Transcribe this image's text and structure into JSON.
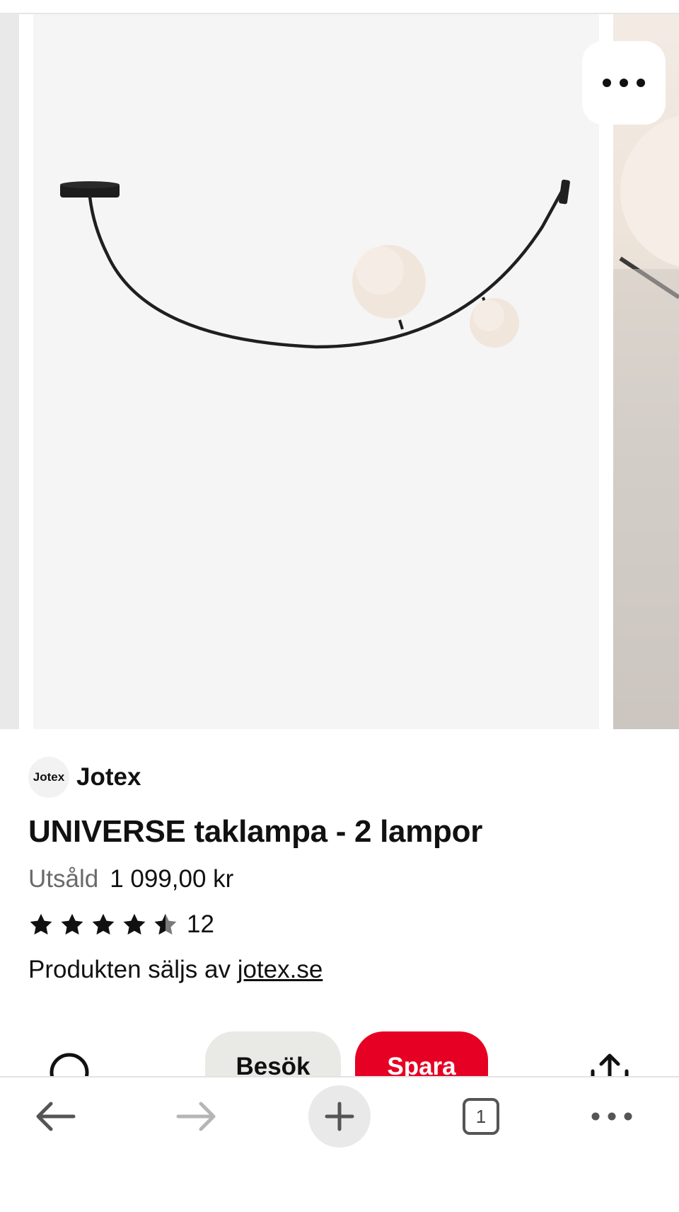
{
  "carousel": {
    "more_icon": "more-horizontal-icon"
  },
  "brand": {
    "logo_text": "Jotex",
    "name": "Jotex"
  },
  "product": {
    "title": "UNIVERSE taklampa - 2 lampor",
    "status": "Utsåld",
    "price": "1 099,00 kr",
    "rating": 4.5,
    "rating_max": 5,
    "review_count": "12",
    "seller_prefix": "Produkten säljs av ",
    "seller_link": "jotex.se"
  },
  "actions": {
    "comment_icon": "comment-icon",
    "visit_label": "Besök",
    "save_label": "Spara",
    "share_icon": "share-icon",
    "save_color": "#e60023"
  },
  "browser_nav": {
    "back_icon": "arrow-left-icon",
    "forward_icon": "arrow-right-icon",
    "new_tab_icon": "plus-icon",
    "tab_count": "1",
    "menu_icon": "more-horizontal-icon"
  }
}
